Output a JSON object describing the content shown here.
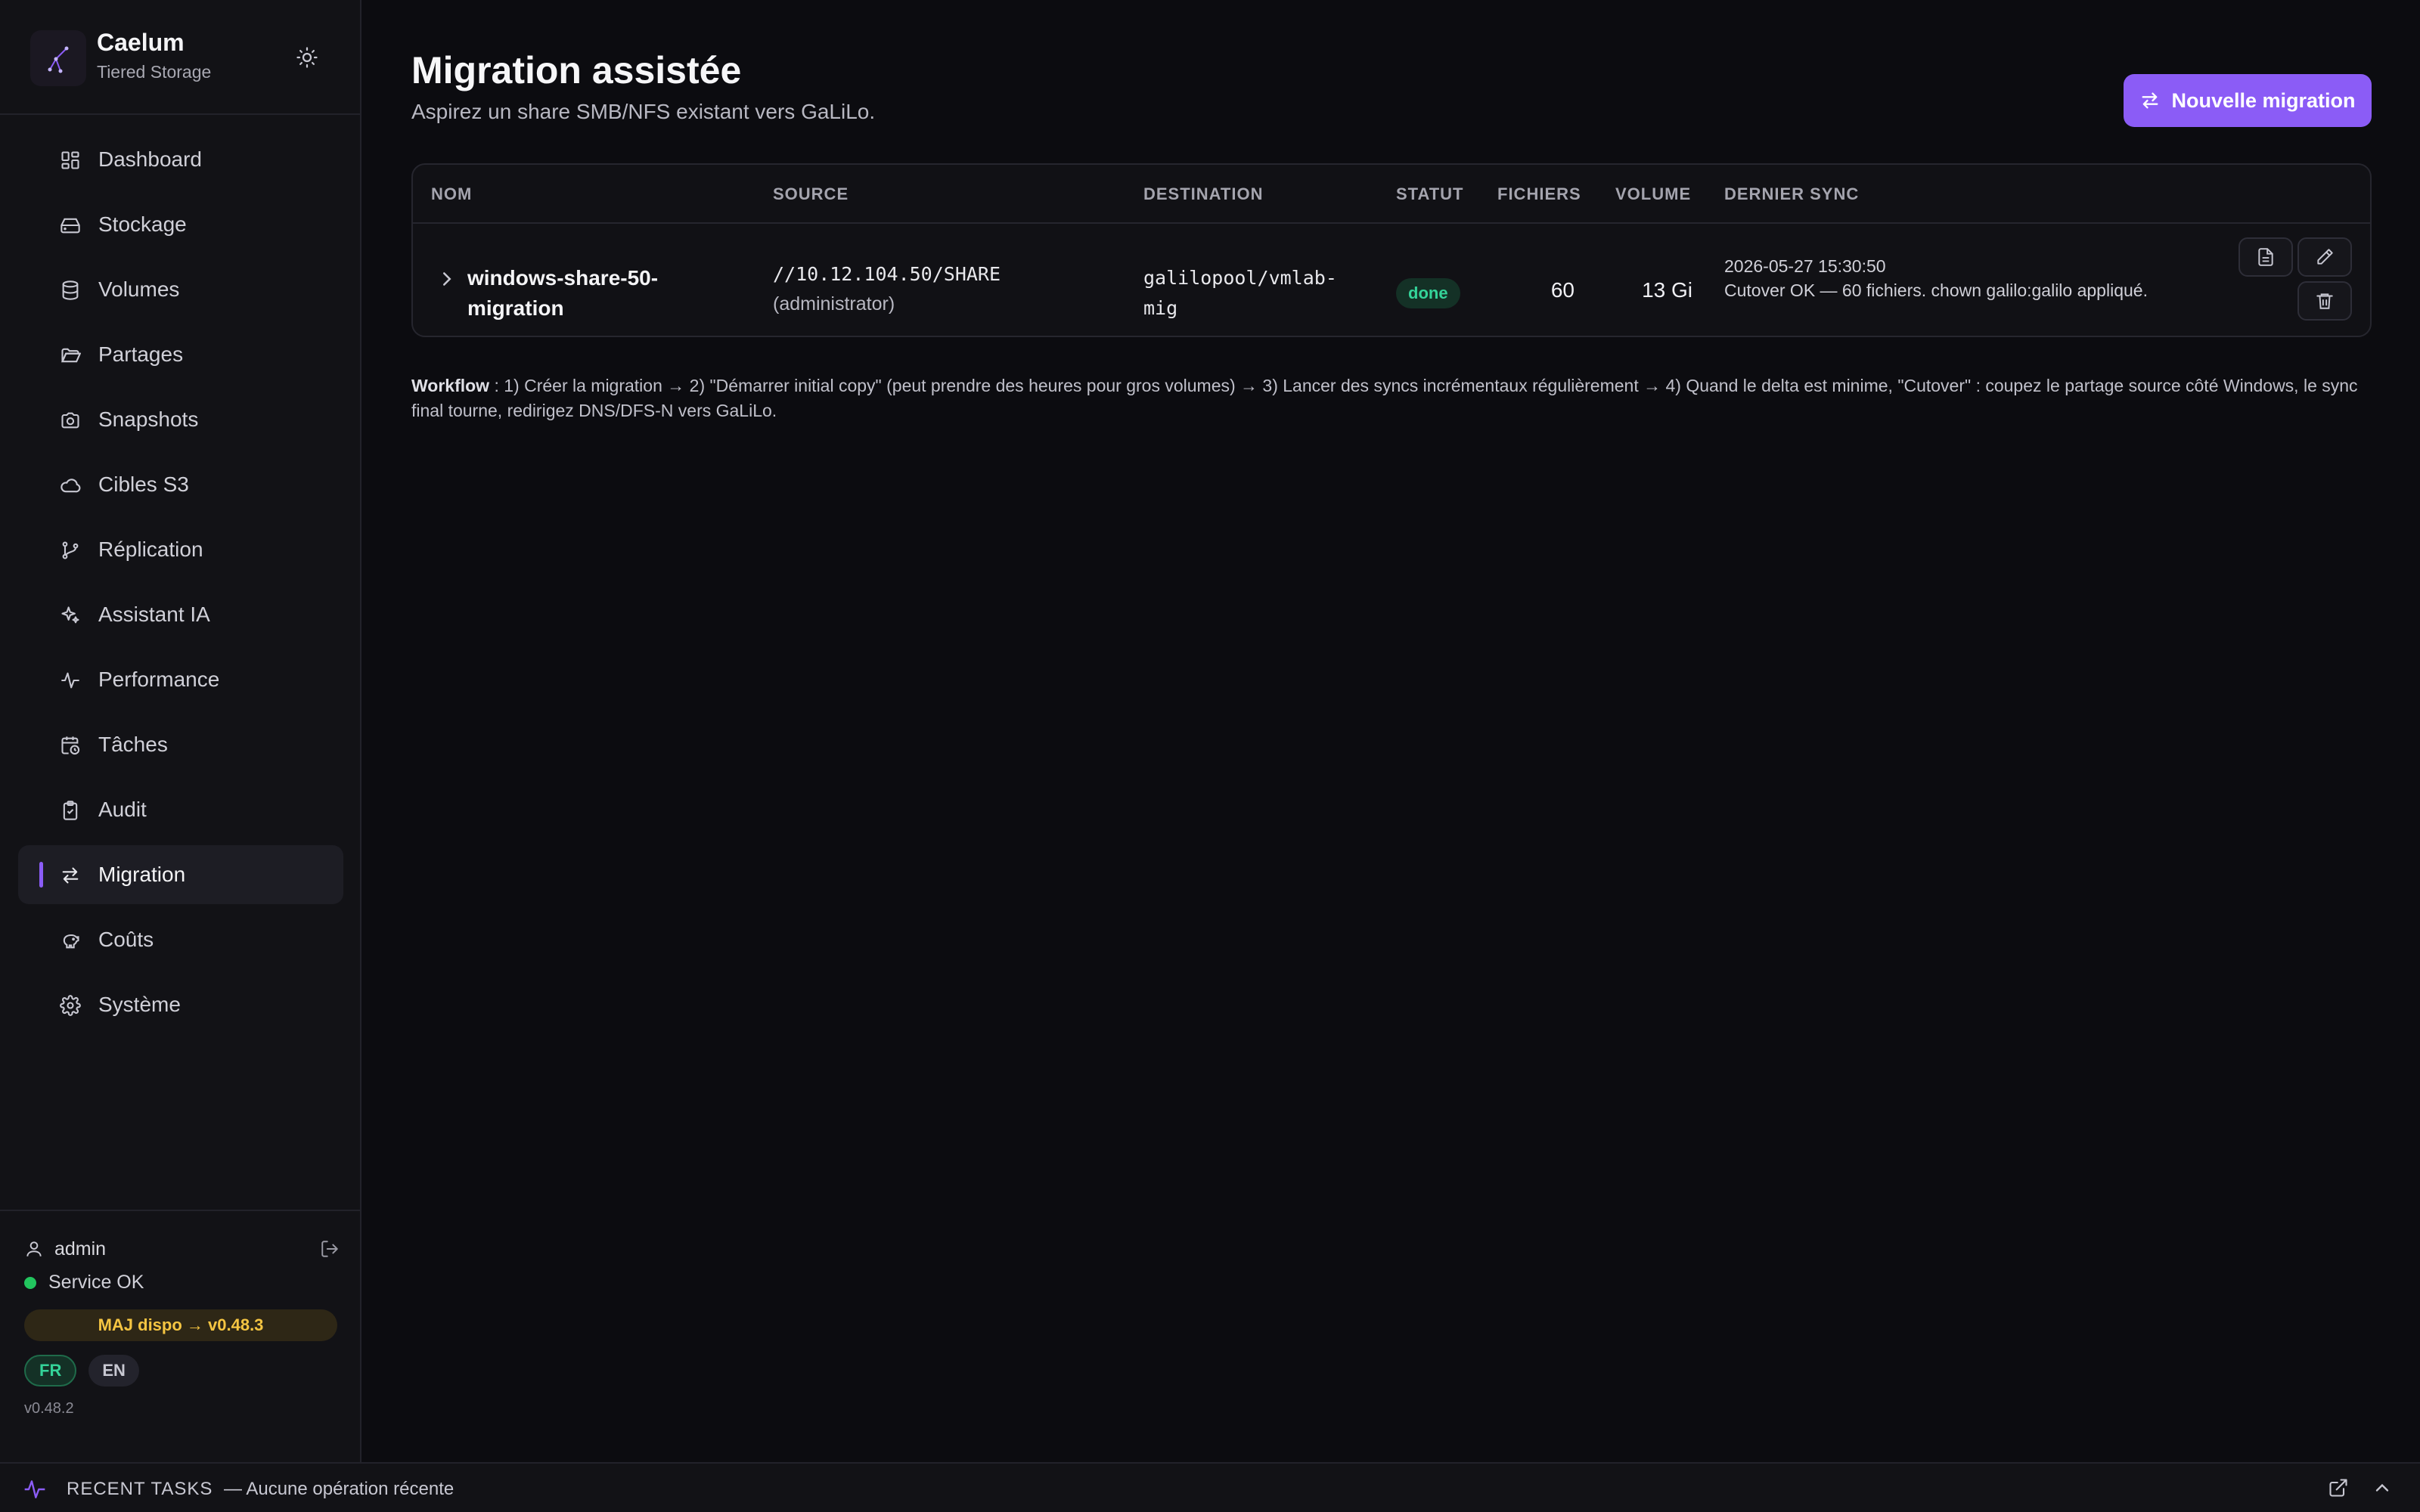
{
  "brand": {
    "name": "Caelum",
    "subtitle": "Tiered Storage"
  },
  "nav": [
    {
      "label": "Dashboard",
      "icon": "dashboard-icon"
    },
    {
      "label": "Stockage",
      "icon": "hard-drive-icon"
    },
    {
      "label": "Volumes",
      "icon": "database-icon"
    },
    {
      "label": "Partages",
      "icon": "folder-open-icon"
    },
    {
      "label": "Snapshots",
      "icon": "camera-icon"
    },
    {
      "label": "Cibles S3",
      "icon": "cloud-icon"
    },
    {
      "label": "Réplication",
      "icon": "git-branch-icon"
    },
    {
      "label": "Assistant IA",
      "icon": "sparkles-icon"
    },
    {
      "label": "Performance",
      "icon": "activity-icon"
    },
    {
      "label": "Tâches",
      "icon": "calendar-clock-icon"
    },
    {
      "label": "Audit",
      "icon": "clipboard-icon"
    },
    {
      "label": "Migration",
      "icon": "arrows-swap-icon",
      "active": true
    },
    {
      "label": "Coûts",
      "icon": "piggy-bank-icon"
    },
    {
      "label": "Système",
      "icon": "gear-icon"
    }
  ],
  "footer": {
    "user": "admin",
    "service_status": "Service OK",
    "update": "MAJ dispo → v0.48.3",
    "lang_fr": "FR",
    "lang_en": "EN",
    "version": "v0.48.2"
  },
  "page": {
    "title": "Migration assistée",
    "subtitle": "Aspirez un share SMB/NFS existant vers GaLiLo.",
    "new_button": "Nouvelle migration"
  },
  "table": {
    "headers": {
      "name": "NOM",
      "source": "SOURCE",
      "destination": "DESTINATION",
      "status": "STATUT",
      "files": "FICHIERS",
      "volume": "VOLUME",
      "last_sync": "DERNIER SYNC"
    },
    "rows": [
      {
        "name": "windows-share-50-migration",
        "source": "//10.12.104.50/SHARE",
        "source_user": "(administrator)",
        "destination": "galilopool/vmlab-mig",
        "status": "done",
        "files": "60",
        "volume": "13 Gi",
        "sync_time": "2026-05-27 15:30:50",
        "sync_message": "Cutover OK — 60 fichiers. chown galilo:galilo appliqué."
      }
    ]
  },
  "workflow": {
    "label": "Workflow",
    "text": " : 1) Créer la migration → 2) \"Démarrer initial copy\" (peut prendre des heures pour gros volumes) → 3) Lancer des syncs incrémentaux régulièrement → 4) Quand le delta est minime, \"Cutover\" : coupez le partage source côté Windows, le sync final tourne, redirigez DNS/DFS-N vers GaLiLo."
  },
  "bottombar": {
    "title": "RECENT TASKS",
    "status": "— Aucune opération récente"
  },
  "colors": {
    "accent": "#8b5cf6",
    "success": "#34d399",
    "warning": "#f5c542",
    "background": "#0c0c10"
  }
}
